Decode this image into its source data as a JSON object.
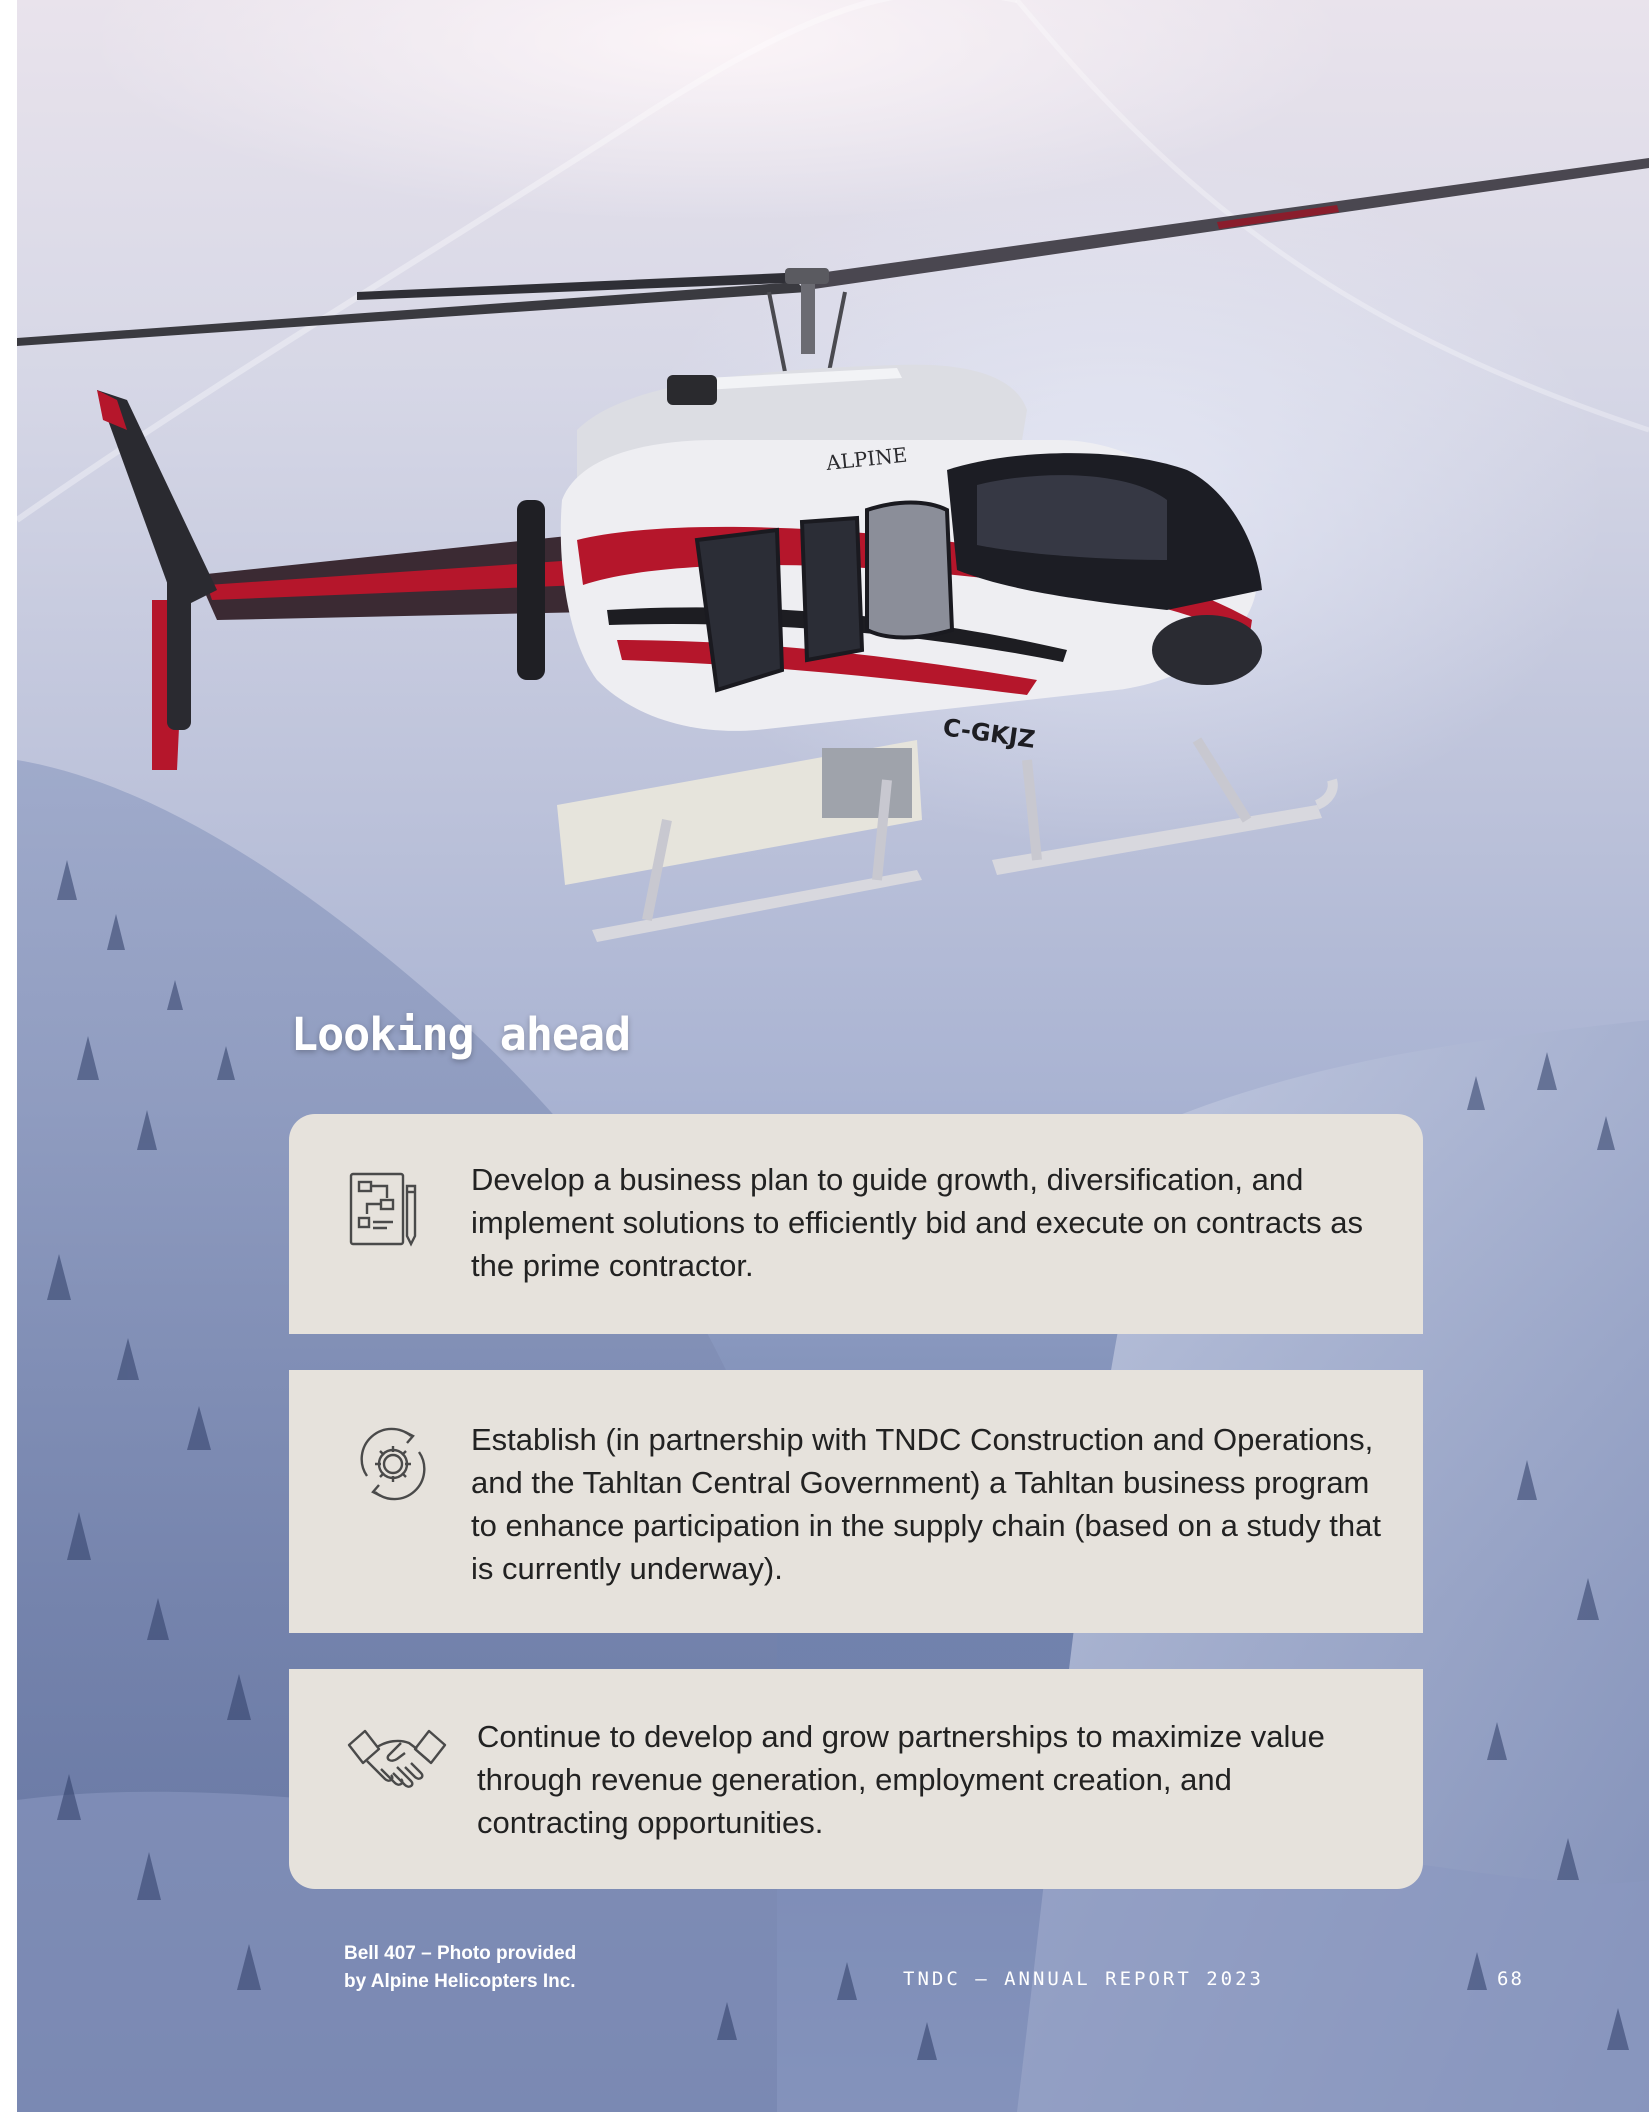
{
  "page": {
    "heading": "Looking ahead",
    "photo_caption_line1": "Bell 407 – Photo provided",
    "photo_caption_line2": "by Alpine Helicopters Inc.",
    "footer_title": "TNDC – ANNUAL REPORT 2023",
    "page_number": "68",
    "helicopter_markings": {
      "brand": "ALPINE",
      "registration": "C-GKJZ"
    }
  },
  "priorities": [
    {
      "icon": "business-plan-icon",
      "text": "Develop a business plan to guide growth, diversification, and implement solutions to efficiently bid and execute on contracts as the prime contractor."
    },
    {
      "icon": "gear-cycle-icon",
      "text": "Establish (in partnership with TNDC Construction and Operations, and the Tahltan Central Government) a Tahltan business program to enhance participation in the supply chain (based on a study that is currently underway)."
    },
    {
      "icon": "handshake-icon",
      "text": "Continue to develop and grow partnerships to maximize value through revenue generation, employment creation, and contracting opportunities."
    }
  ],
  "colors": {
    "card_background": "#e6e2dc",
    "text_dark": "#222222",
    "helicopter_red": "#b5162b",
    "sky_snow": "#d6d7e6",
    "forest_blue": "#6d7fab"
  }
}
